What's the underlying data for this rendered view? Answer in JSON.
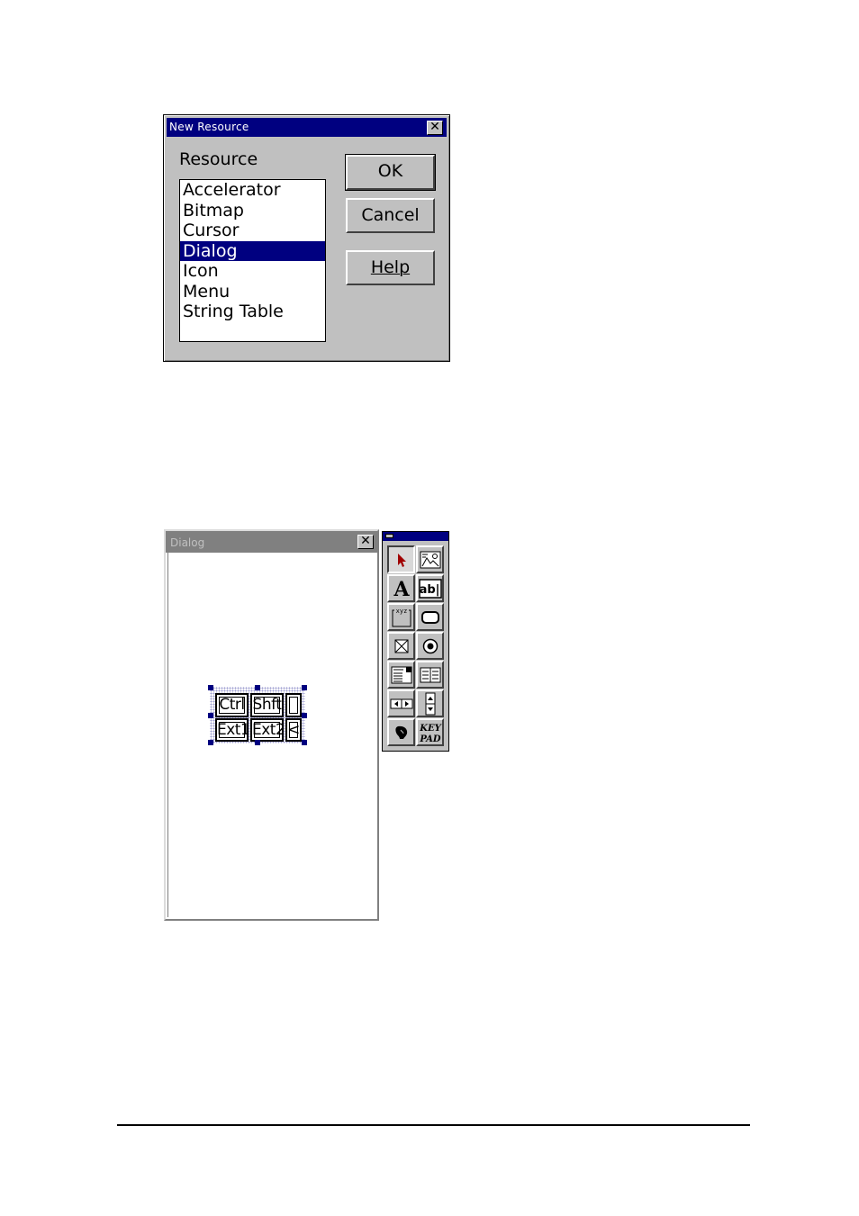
{
  "new_resource_dialog": {
    "title": "New Resource",
    "close_label": "✕",
    "resource_label": "Resource",
    "items": [
      "Accelerator",
      "Bitmap",
      "Cursor",
      "Dialog",
      "Icon",
      "Menu",
      "String Table"
    ],
    "selected_item": "Dialog",
    "ok_label": "OK",
    "cancel_label": "Cancel",
    "help_label": "Help"
  },
  "dialog_window": {
    "title": "Dialog",
    "close_label": "✕",
    "keypad": {
      "keys": [
        "Ctrl",
        "Shft",
        "",
        "Ext1",
        "Ext2",
        "<"
      ]
    }
  },
  "toolbox": {
    "tools": [
      {
        "name": "pointer-tool-icon"
      },
      {
        "name": "picture-tool-icon"
      },
      {
        "name": "static-text-tool-icon",
        "glyph": "A"
      },
      {
        "name": "edit-box-tool-icon",
        "glyph": "ab|"
      },
      {
        "name": "group-box-tool-icon",
        "glyph": "xyz"
      },
      {
        "name": "push-button-tool-icon"
      },
      {
        "name": "check-box-tool-icon"
      },
      {
        "name": "radio-button-tool-icon"
      },
      {
        "name": "combo-box-tool-icon"
      },
      {
        "name": "list-box-tool-icon"
      },
      {
        "name": "horizontal-scroll-tool-icon"
      },
      {
        "name": "vertical-scroll-tool-icon"
      },
      {
        "name": "custom-control-tool-icon"
      },
      {
        "name": "keypad-tool-icon",
        "glyph_line1": "KEY",
        "glyph_line2": "PAD"
      }
    ]
  },
  "colors": {
    "active_title": "#000080",
    "inactive_title": "#808080",
    "face": "#c0c0c0",
    "selection": "#000080"
  }
}
